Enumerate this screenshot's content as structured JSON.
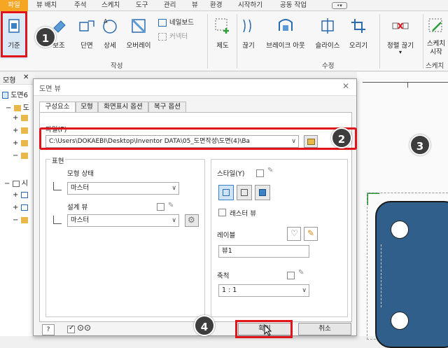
{
  "tabs": [
    "파일",
    "뷰 배치",
    "주석",
    "스케치",
    "도구",
    "관리",
    "뷰",
    "환경",
    "시작하기",
    "공동 작업"
  ],
  "ribbon": {
    "buttons": [
      "기준",
      "보조",
      "단면",
      "상세",
      "오버레이",
      "제도",
      "끊기",
      "브레이크 아웃",
      "슬라이스",
      "오리기",
      "정렬 끊기"
    ],
    "small_items": [
      "네일보드",
      "커넥터"
    ],
    "last_button_lines": [
      "스케치",
      "시작"
    ],
    "panels": [
      "작성",
      "수정",
      "스케치"
    ]
  },
  "browser": {
    "header": "모형",
    "close": "✕",
    "root": "도면6",
    "item1": "도",
    "item2": "시"
  },
  "dialog": {
    "title": "도면 뷰",
    "close": "✕",
    "tabs": [
      "구성요소",
      "모형",
      "화면표시 옵션",
      "복구 옵션"
    ],
    "file_label": "파일(F)",
    "file_path": "C:\\Users\\DOKAEBI\\Desktop\\Inventor DATA\\05_도면작성\\도면(4)\\Ba",
    "representation_label": "표현",
    "model_state_label": "모형 상태",
    "model_state_value": "마스터",
    "design_view_label": "설계 뷰",
    "design_view_value": "마스터",
    "style_label": "스타일(Y)",
    "raster_label": "래스터 뷰",
    "label_label": "레이블",
    "label_value": "뷰1",
    "scale_label": "축척",
    "scale_value": "1 : 1",
    "ok": "확인",
    "cancel": "취소",
    "help": "?"
  },
  "callouts": [
    "1",
    "2",
    "3",
    "4"
  ],
  "colors": {
    "file_tab": "#f5a623",
    "callout_bg": "#3d3d3d",
    "highlight_red": "#e0151b",
    "part_blue": "#2f5f8a"
  }
}
